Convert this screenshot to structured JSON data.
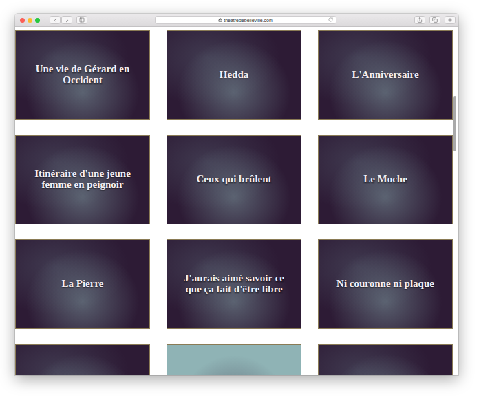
{
  "window": {
    "url": "theatredebelleville.com"
  },
  "shows": [
    {
      "title": "Une vie de Gérard en Occident"
    },
    {
      "title": "Hedda"
    },
    {
      "title": "L'Anniversaire"
    },
    {
      "title": "Itinéraire d'une jeune femme en peignoir"
    },
    {
      "title": "Ceux qui brûlent"
    },
    {
      "title": "Le Moche"
    },
    {
      "title": "La Pierre"
    },
    {
      "title": "J'aurais aimé savoir ce que ça fait d'être libre"
    },
    {
      "title": "Ni couronne ni plaque"
    }
  ],
  "more_shows": [
    {
      "tone": "dark"
    },
    {
      "tone": "light"
    },
    {
      "tone": "dark"
    }
  ],
  "scrollbar": {
    "level": 0.16
  }
}
